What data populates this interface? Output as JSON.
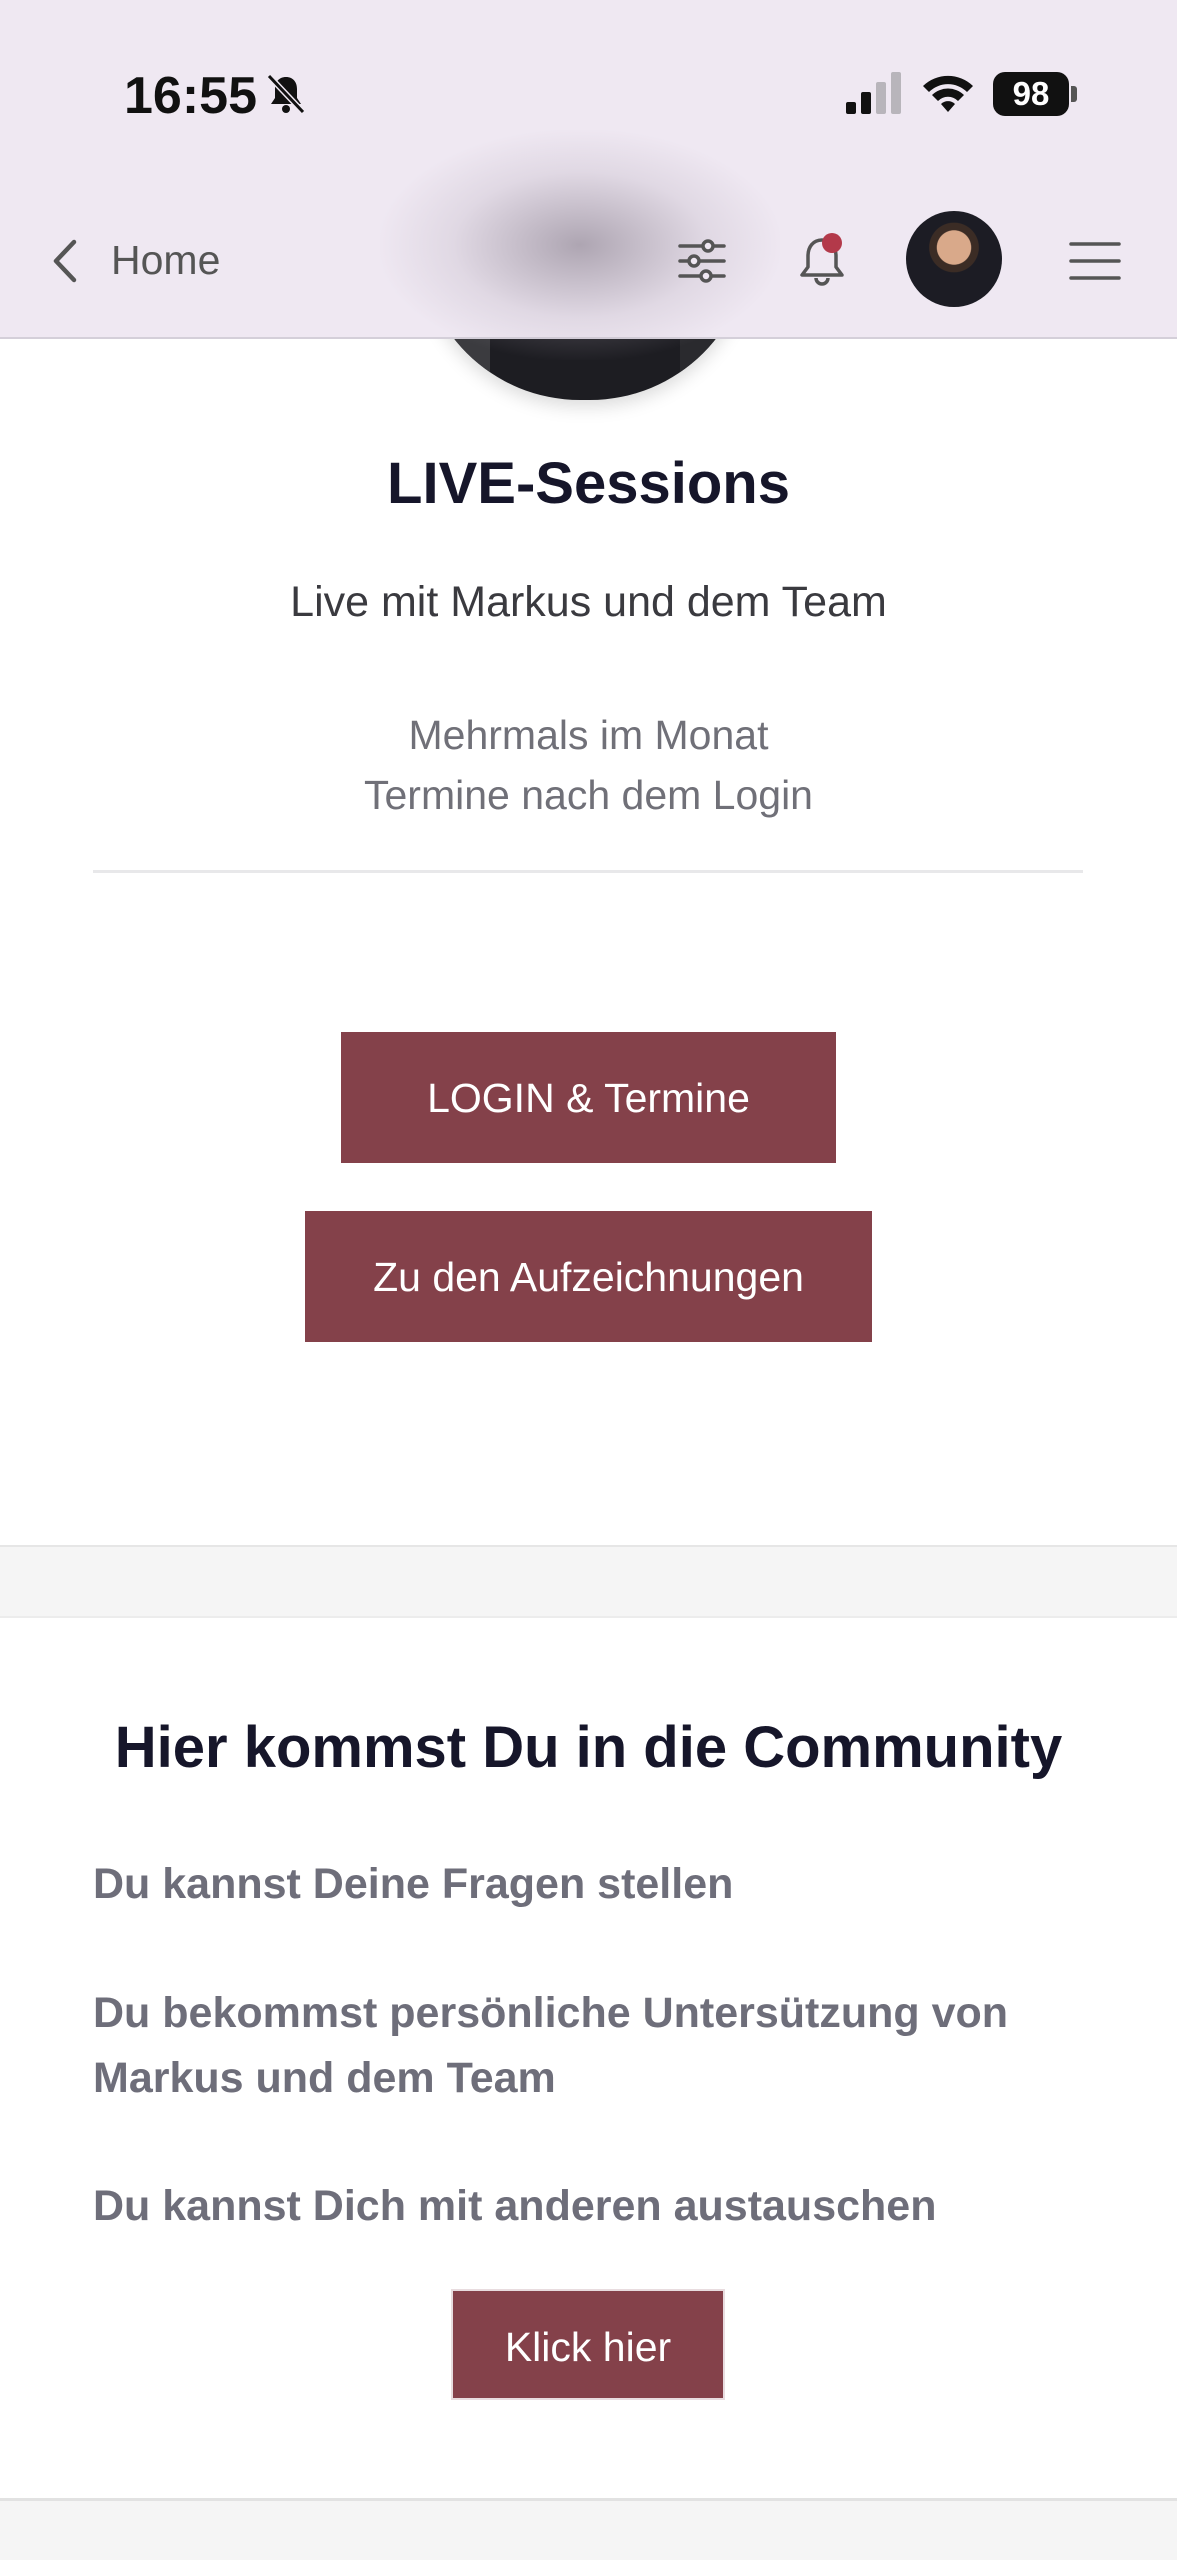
{
  "status_bar": {
    "time": "16:55",
    "battery": "98"
  },
  "nav": {
    "back_label": "Home"
  },
  "live_section": {
    "title": "LIVE-Sessions",
    "subtitle": "Live mit Markus und dem Team",
    "info_line1": "Mehrmals im Monat",
    "info_line2": "Termine nach dem Login",
    "login_button": "LOGIN & Termine",
    "recordings_button": "Zu den Aufzeichnungen"
  },
  "community_section": {
    "title": "Hier kommst Du in die Community",
    "features": [
      "Du kannst Deine Fragen stellen",
      "Du bekommst persönliche Untersützung von Markus und dem Team",
      "Du kannst Dich mit anderen austauschen"
    ],
    "cta_button": "Klick hier"
  },
  "colors": {
    "accent": "#84414a",
    "notification_dot": "#b3394a",
    "topbar": "#efe8f2"
  },
  "icons": [
    "bell-off-icon",
    "signal-icon",
    "wifi-icon",
    "battery-icon",
    "back-chevron-icon",
    "filter-icon",
    "bell-icon",
    "menu-icon"
  ]
}
